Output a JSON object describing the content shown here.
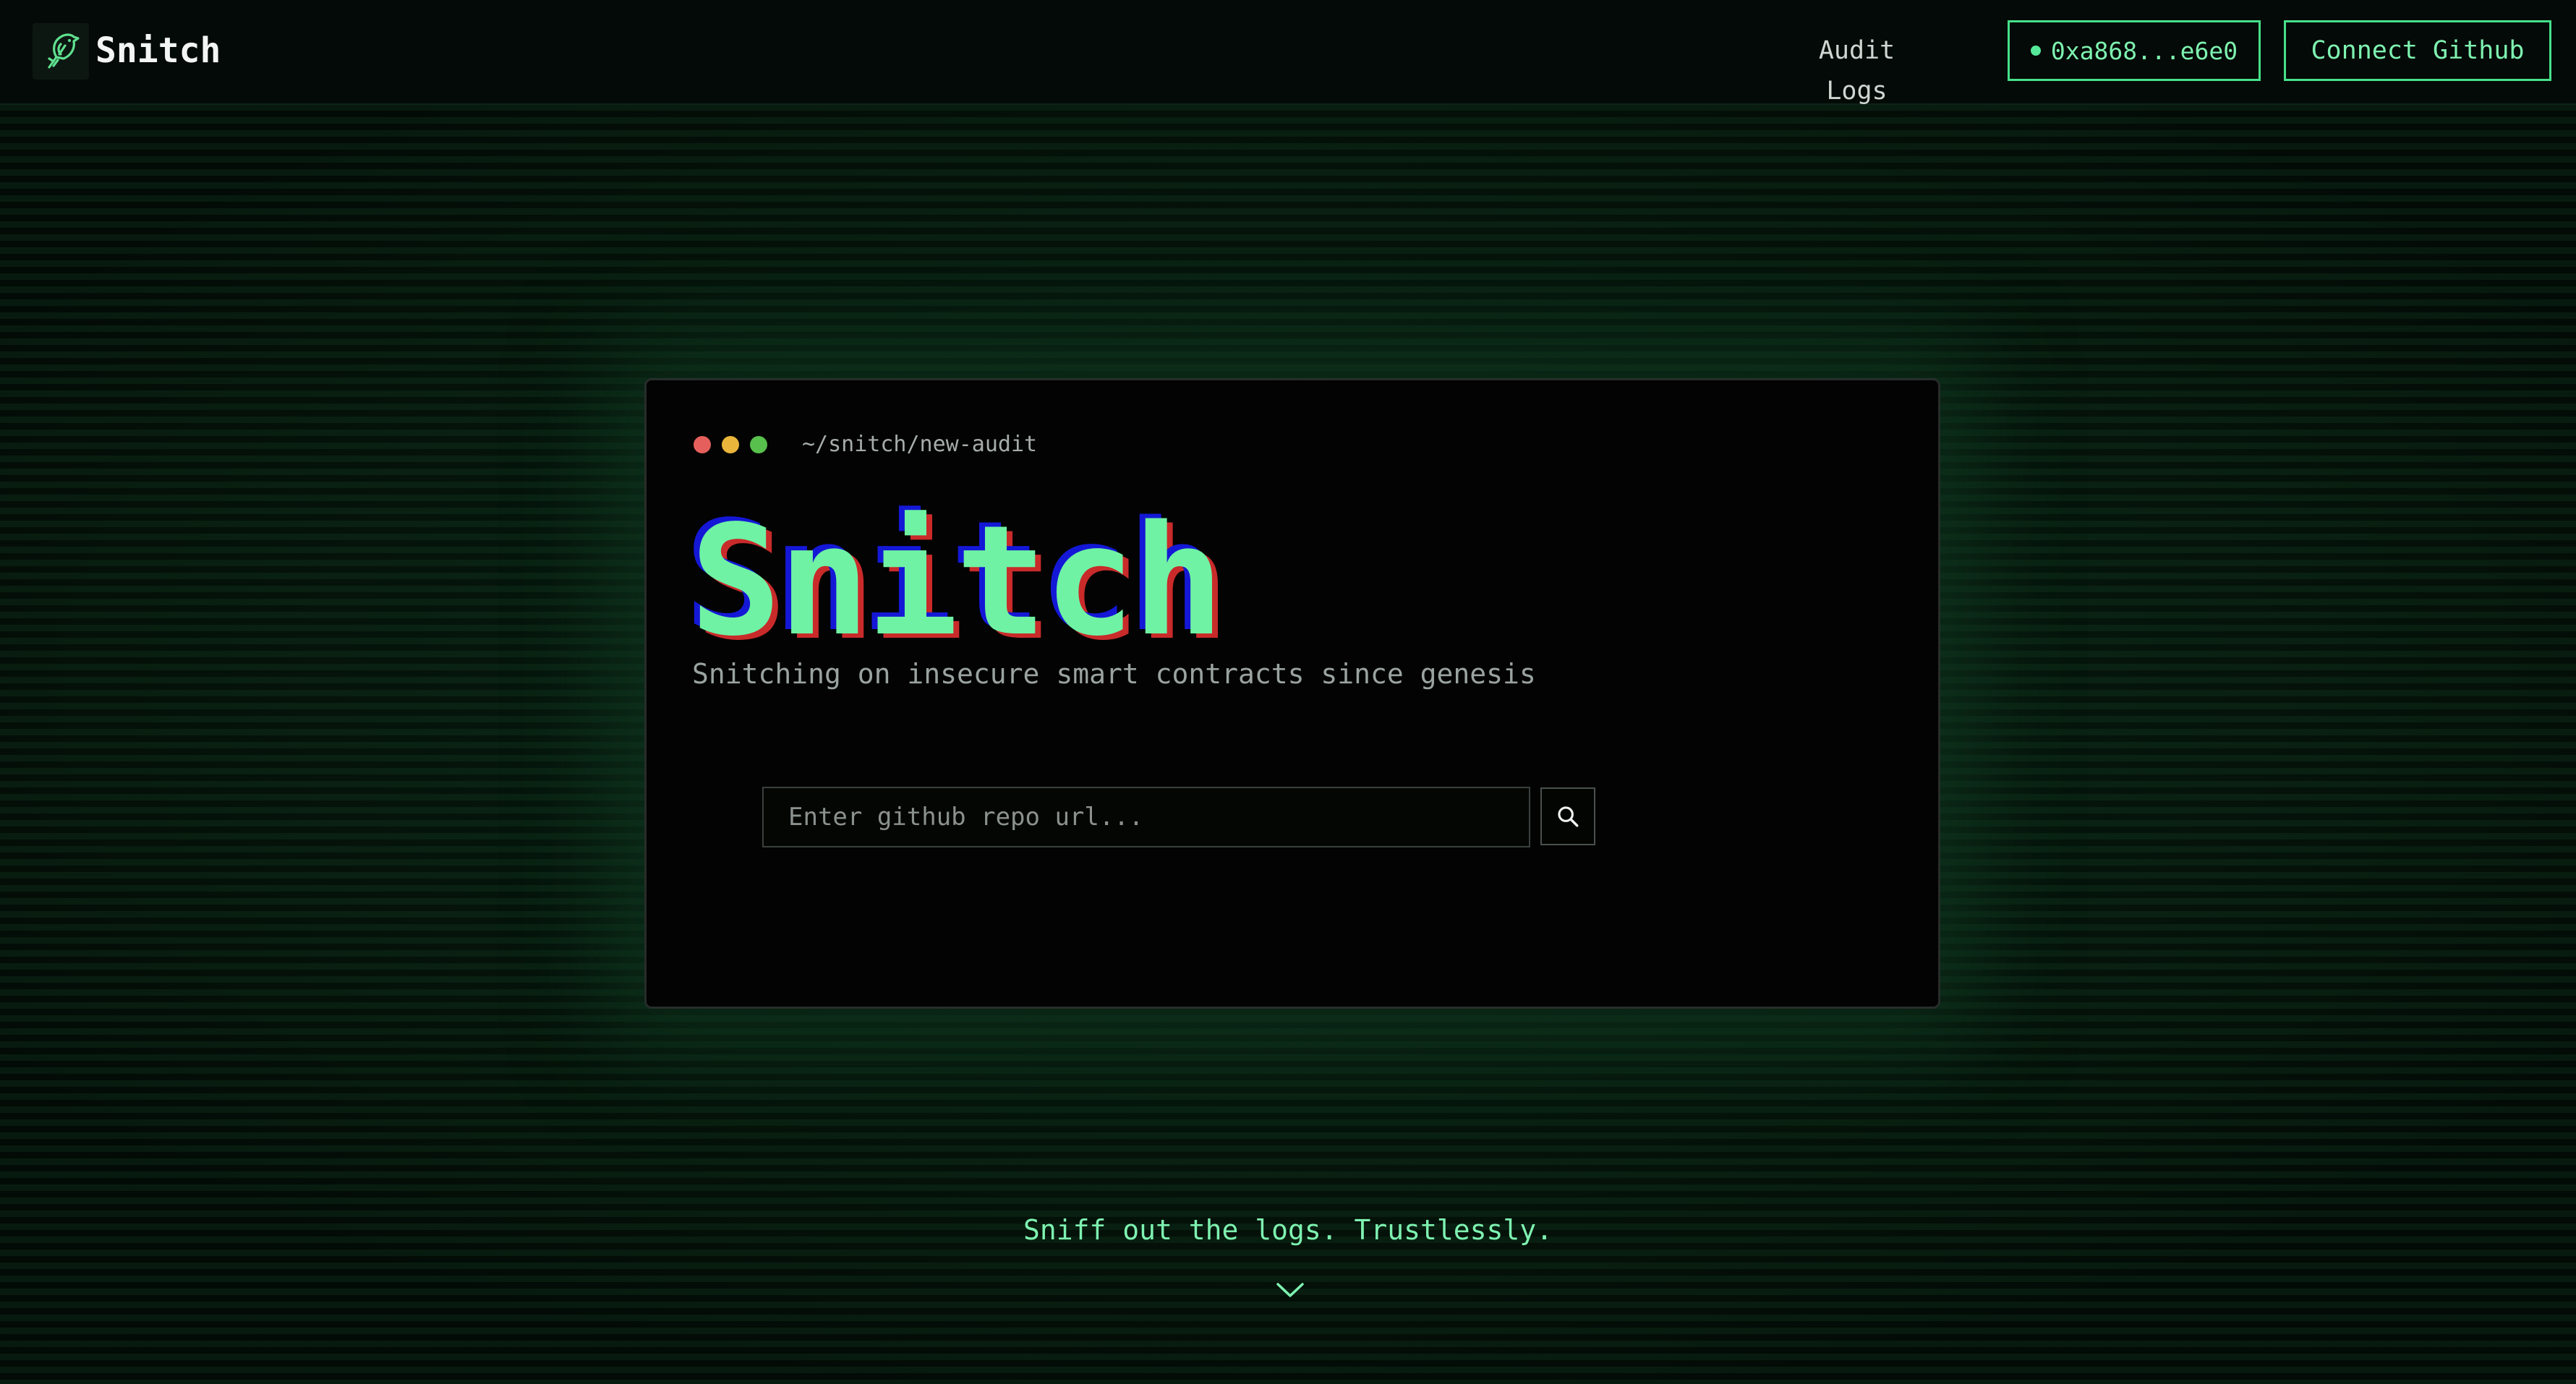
{
  "header": {
    "brand": "Snitch",
    "logo_icon": "bird-icon",
    "nav": {
      "audit_logs_label": "Audit Logs"
    },
    "wallet": {
      "address": "0xa868...e6e0",
      "status_color": "#55e89a"
    },
    "github_button_label": "Connect Github"
  },
  "terminal": {
    "window_controls": [
      "red",
      "yellow",
      "green"
    ],
    "path": "~/snitch/new-audit",
    "title": "Snitch",
    "subtitle": "Snitching on insecure smart contracts since genesis",
    "search": {
      "placeholder": "Enter github repo url...",
      "value": "",
      "button_icon": "search-icon"
    }
  },
  "footer": {
    "tagline": "Sniff out the logs. Trustlessly.",
    "scroll_icon": "chevron-down-icon"
  },
  "colors": {
    "accent": "#46e08a",
    "accent_text": "#7ef2b0",
    "title_green": "#6ff2a4",
    "glitch_blue": "#1418d6",
    "glitch_red": "#c92a2a",
    "background": "#030a06"
  }
}
